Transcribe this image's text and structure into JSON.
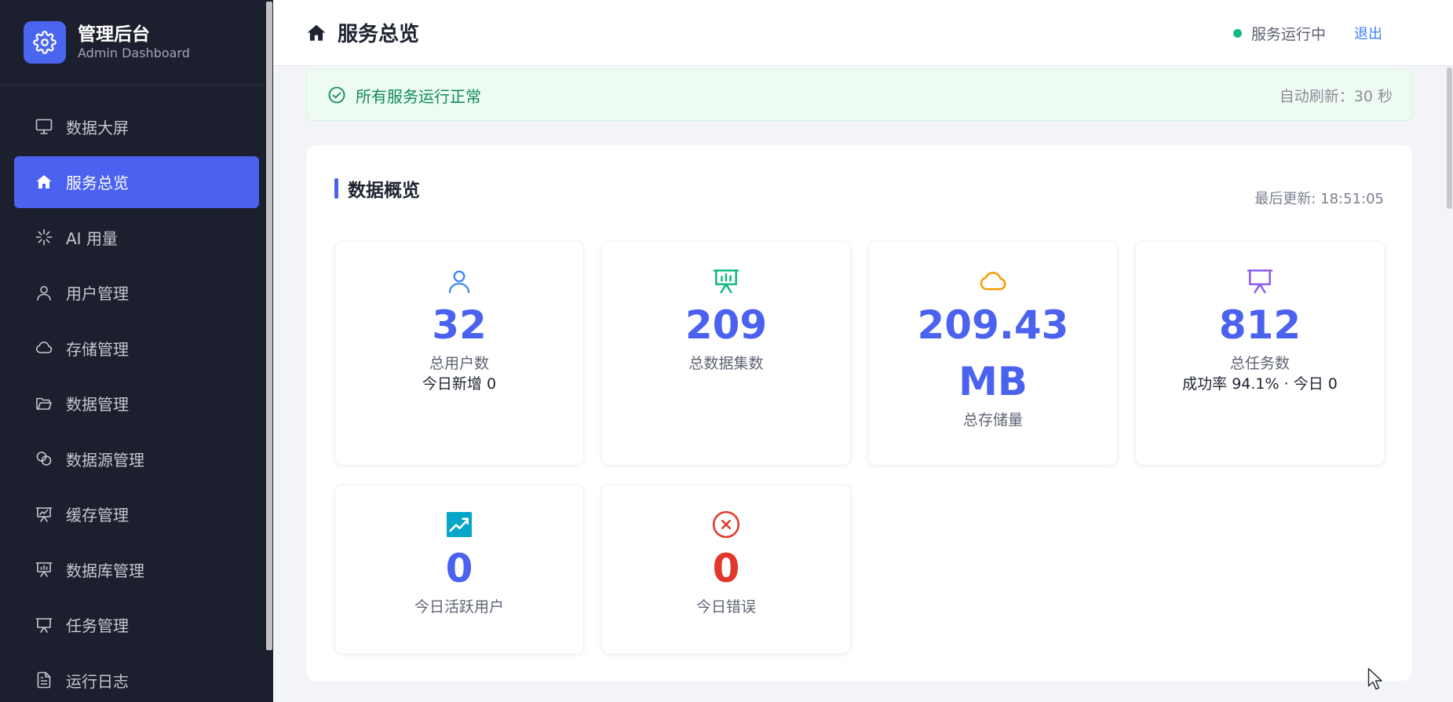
{
  "brand": {
    "title": "管理后台",
    "subtitle": "Admin Dashboard"
  },
  "sidebar": {
    "items": [
      {
        "label": "数据大屏",
        "icon": "monitor-icon",
        "active": false
      },
      {
        "label": "服务总览",
        "icon": "home-icon",
        "active": true
      },
      {
        "label": "AI 用量",
        "icon": "sparkle-icon",
        "active": false
      },
      {
        "label": "用户管理",
        "icon": "user-icon",
        "active": false
      },
      {
        "label": "存储管理",
        "icon": "cloud-icon",
        "active": false
      },
      {
        "label": "数据管理",
        "icon": "folder-icon",
        "active": false
      },
      {
        "label": "数据源管理",
        "icon": "link-icon",
        "active": false
      },
      {
        "label": "缓存管理",
        "icon": "presentation-chart-icon",
        "active": false
      },
      {
        "label": "数据库管理",
        "icon": "presentation-bars-icon",
        "active": false
      },
      {
        "label": "任务管理",
        "icon": "presentation-icon",
        "active": false
      },
      {
        "label": "运行日志",
        "icon": "document-icon",
        "active": false
      }
    ]
  },
  "header": {
    "title": "服务总览",
    "status": "服务运行中",
    "logout": "退出"
  },
  "alert": {
    "message": "所有服务运行正常",
    "refresh": "自动刷新：30 秒"
  },
  "overview": {
    "title": "数据概览",
    "updated": "最后更新: 18:51:05",
    "stats": [
      {
        "value": "32",
        "label": "总用户数",
        "sub": "今日新增 0",
        "icon": "user-icon",
        "icon_color": "#3b82f6"
      },
      {
        "value": "209",
        "label": "总数据集数",
        "sub": "",
        "icon": "presentation-chart-icon",
        "icon_color": "#10b981"
      },
      {
        "value_line1": "209.43",
        "value_line2": "MB",
        "label": "总存储量",
        "sub": "",
        "icon": "cloud-icon",
        "icon_color": "#f59e0b"
      },
      {
        "value": "812",
        "label": "总任务数",
        "sub": "成功率 94.1% · 今日 0",
        "icon": "presentation-icon",
        "icon_color": "#8b5cf6"
      },
      {
        "value": "0",
        "label": "今日活跃用户",
        "sub": "",
        "icon": "trend-chart-icon",
        "icon_color": "#06a6c9"
      },
      {
        "value": "0",
        "label": "今日错误",
        "sub": "",
        "icon": "error-circle-icon",
        "icon_color": "#e2382c"
      }
    ]
  },
  "colors": {
    "sidebar_bg": "#1c1f2e",
    "accent": "#4a62ef",
    "success": "#14b882",
    "danger": "#e2382c"
  }
}
